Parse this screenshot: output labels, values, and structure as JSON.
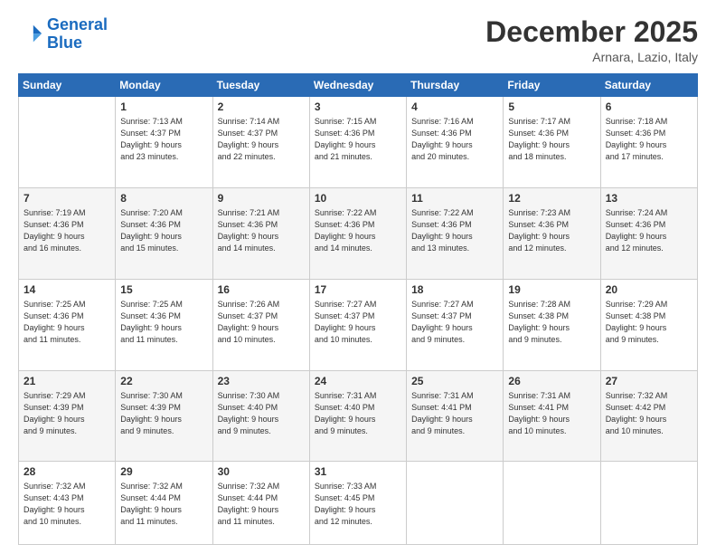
{
  "logo": {
    "line1": "General",
    "line2": "Blue"
  },
  "header": {
    "month": "December 2025",
    "location": "Arnara, Lazio, Italy"
  },
  "days_of_week": [
    "Sunday",
    "Monday",
    "Tuesday",
    "Wednesday",
    "Thursday",
    "Friday",
    "Saturday"
  ],
  "weeks": [
    [
      {
        "day": "",
        "sunrise": "",
        "sunset": "",
        "daylight": ""
      },
      {
        "day": "1",
        "sunrise": "Sunrise: 7:13 AM",
        "sunset": "Sunset: 4:37 PM",
        "daylight": "Daylight: 9 hours and 23 minutes."
      },
      {
        "day": "2",
        "sunrise": "Sunrise: 7:14 AM",
        "sunset": "Sunset: 4:37 PM",
        "daylight": "Daylight: 9 hours and 22 minutes."
      },
      {
        "day": "3",
        "sunrise": "Sunrise: 7:15 AM",
        "sunset": "Sunset: 4:36 PM",
        "daylight": "Daylight: 9 hours and 21 minutes."
      },
      {
        "day": "4",
        "sunrise": "Sunrise: 7:16 AM",
        "sunset": "Sunset: 4:36 PM",
        "daylight": "Daylight: 9 hours and 20 minutes."
      },
      {
        "day": "5",
        "sunrise": "Sunrise: 7:17 AM",
        "sunset": "Sunset: 4:36 PM",
        "daylight": "Daylight: 9 hours and 18 minutes."
      },
      {
        "day": "6",
        "sunrise": "Sunrise: 7:18 AM",
        "sunset": "Sunset: 4:36 PM",
        "daylight": "Daylight: 9 hours and 17 minutes."
      }
    ],
    [
      {
        "day": "7",
        "sunrise": "Sunrise: 7:19 AM",
        "sunset": "Sunset: 4:36 PM",
        "daylight": "Daylight: 9 hours and 16 minutes."
      },
      {
        "day": "8",
        "sunrise": "Sunrise: 7:20 AM",
        "sunset": "Sunset: 4:36 PM",
        "daylight": "Daylight: 9 hours and 15 minutes."
      },
      {
        "day": "9",
        "sunrise": "Sunrise: 7:21 AM",
        "sunset": "Sunset: 4:36 PM",
        "daylight": "Daylight: 9 hours and 14 minutes."
      },
      {
        "day": "10",
        "sunrise": "Sunrise: 7:22 AM",
        "sunset": "Sunset: 4:36 PM",
        "daylight": "Daylight: 9 hours and 14 minutes."
      },
      {
        "day": "11",
        "sunrise": "Sunrise: 7:22 AM",
        "sunset": "Sunset: 4:36 PM",
        "daylight": "Daylight: 9 hours and 13 minutes."
      },
      {
        "day": "12",
        "sunrise": "Sunrise: 7:23 AM",
        "sunset": "Sunset: 4:36 PM",
        "daylight": "Daylight: 9 hours and 12 minutes."
      },
      {
        "day": "13",
        "sunrise": "Sunrise: 7:24 AM",
        "sunset": "Sunset: 4:36 PM",
        "daylight": "Daylight: 9 hours and 12 minutes."
      }
    ],
    [
      {
        "day": "14",
        "sunrise": "Sunrise: 7:25 AM",
        "sunset": "Sunset: 4:36 PM",
        "daylight": "Daylight: 9 hours and 11 minutes."
      },
      {
        "day": "15",
        "sunrise": "Sunrise: 7:25 AM",
        "sunset": "Sunset: 4:36 PM",
        "daylight": "Daylight: 9 hours and 11 minutes."
      },
      {
        "day": "16",
        "sunrise": "Sunrise: 7:26 AM",
        "sunset": "Sunset: 4:37 PM",
        "daylight": "Daylight: 9 hours and 10 minutes."
      },
      {
        "day": "17",
        "sunrise": "Sunrise: 7:27 AM",
        "sunset": "Sunset: 4:37 PM",
        "daylight": "Daylight: 9 hours and 10 minutes."
      },
      {
        "day": "18",
        "sunrise": "Sunrise: 7:27 AM",
        "sunset": "Sunset: 4:37 PM",
        "daylight": "Daylight: 9 hours and 9 minutes."
      },
      {
        "day": "19",
        "sunrise": "Sunrise: 7:28 AM",
        "sunset": "Sunset: 4:38 PM",
        "daylight": "Daylight: 9 hours and 9 minutes."
      },
      {
        "day": "20",
        "sunrise": "Sunrise: 7:29 AM",
        "sunset": "Sunset: 4:38 PM",
        "daylight": "Daylight: 9 hours and 9 minutes."
      }
    ],
    [
      {
        "day": "21",
        "sunrise": "Sunrise: 7:29 AM",
        "sunset": "Sunset: 4:39 PM",
        "daylight": "Daylight: 9 hours and 9 minutes."
      },
      {
        "day": "22",
        "sunrise": "Sunrise: 7:30 AM",
        "sunset": "Sunset: 4:39 PM",
        "daylight": "Daylight: 9 hours and 9 minutes."
      },
      {
        "day": "23",
        "sunrise": "Sunrise: 7:30 AM",
        "sunset": "Sunset: 4:40 PM",
        "daylight": "Daylight: 9 hours and 9 minutes."
      },
      {
        "day": "24",
        "sunrise": "Sunrise: 7:31 AM",
        "sunset": "Sunset: 4:40 PM",
        "daylight": "Daylight: 9 hours and 9 minutes."
      },
      {
        "day": "25",
        "sunrise": "Sunrise: 7:31 AM",
        "sunset": "Sunset: 4:41 PM",
        "daylight": "Daylight: 9 hours and 9 minutes."
      },
      {
        "day": "26",
        "sunrise": "Sunrise: 7:31 AM",
        "sunset": "Sunset: 4:41 PM",
        "daylight": "Daylight: 9 hours and 10 minutes."
      },
      {
        "day": "27",
        "sunrise": "Sunrise: 7:32 AM",
        "sunset": "Sunset: 4:42 PM",
        "daylight": "Daylight: 9 hours and 10 minutes."
      }
    ],
    [
      {
        "day": "28",
        "sunrise": "Sunrise: 7:32 AM",
        "sunset": "Sunset: 4:43 PM",
        "daylight": "Daylight: 9 hours and 10 minutes."
      },
      {
        "day": "29",
        "sunrise": "Sunrise: 7:32 AM",
        "sunset": "Sunset: 4:44 PM",
        "daylight": "Daylight: 9 hours and 11 minutes."
      },
      {
        "day": "30",
        "sunrise": "Sunrise: 7:32 AM",
        "sunset": "Sunset: 4:44 PM",
        "daylight": "Daylight: 9 hours and 11 minutes."
      },
      {
        "day": "31",
        "sunrise": "Sunrise: 7:33 AM",
        "sunset": "Sunset: 4:45 PM",
        "daylight": "Daylight: 9 hours and 12 minutes."
      },
      {
        "day": "",
        "sunrise": "",
        "sunset": "",
        "daylight": ""
      },
      {
        "day": "",
        "sunrise": "",
        "sunset": "",
        "daylight": ""
      },
      {
        "day": "",
        "sunrise": "",
        "sunset": "",
        "daylight": ""
      }
    ]
  ]
}
